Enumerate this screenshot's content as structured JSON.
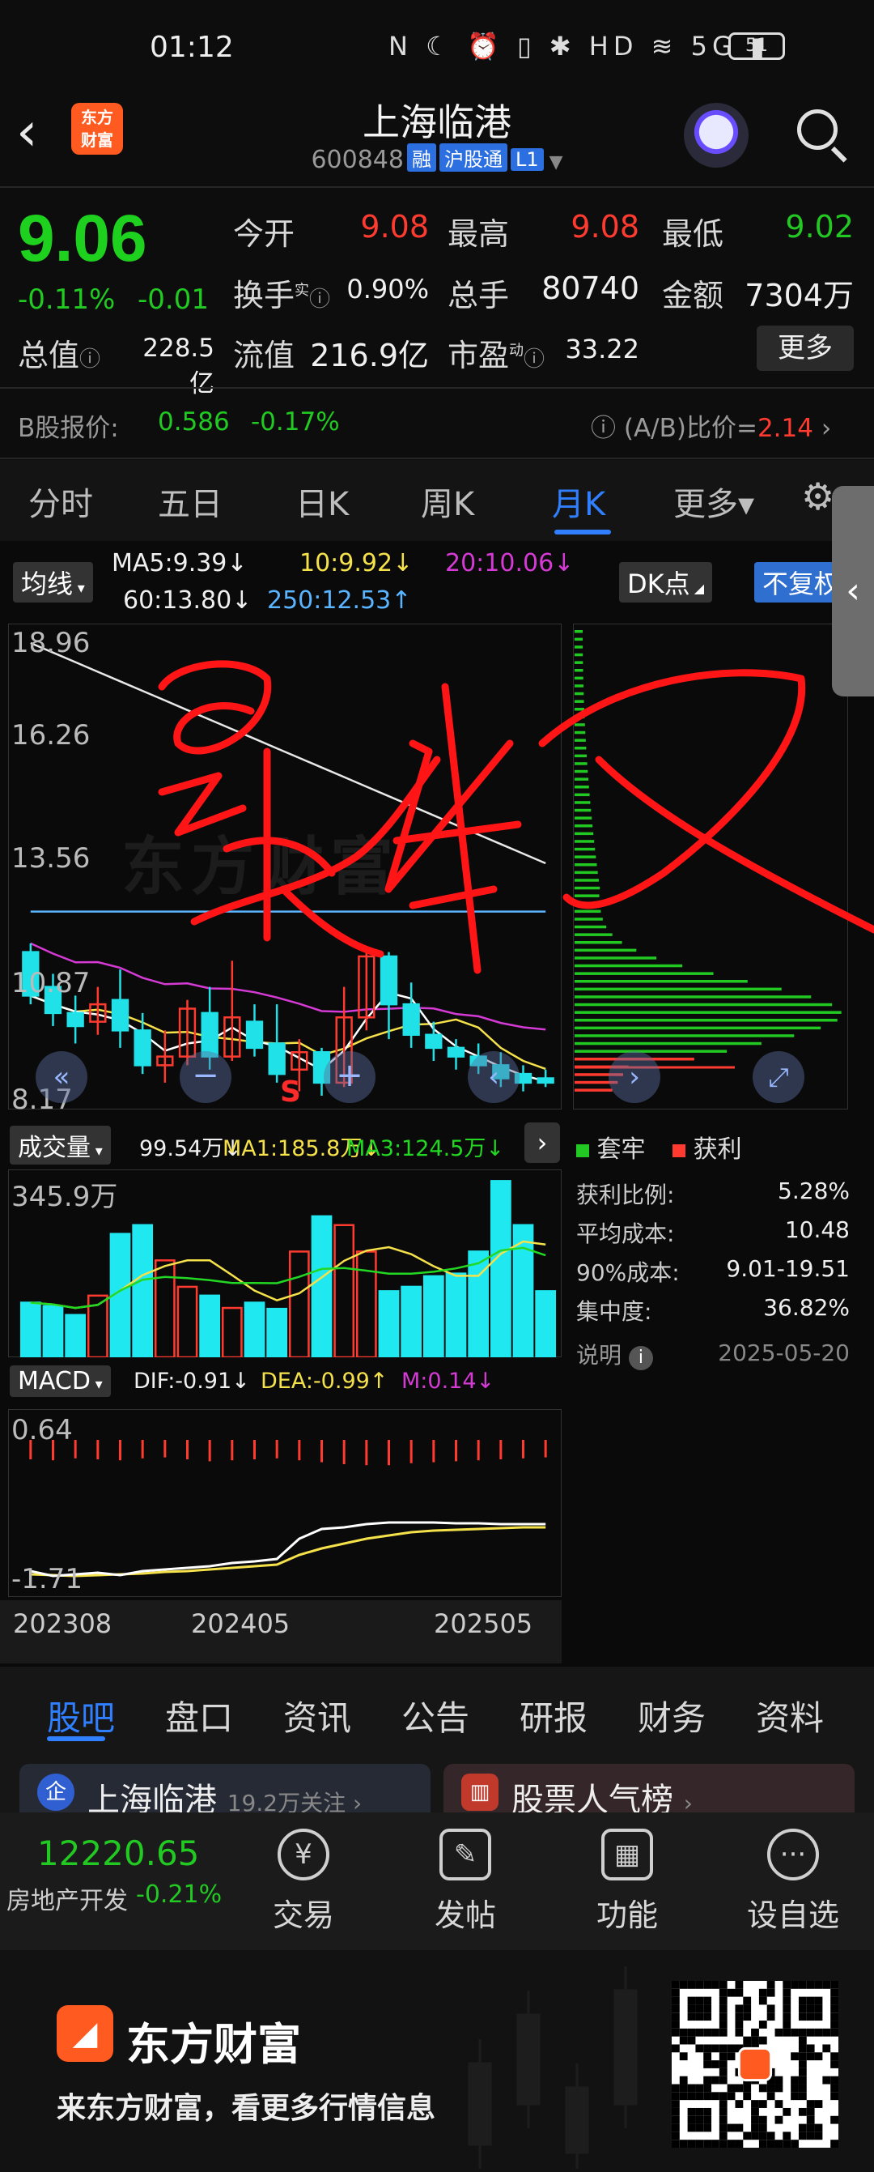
{
  "status": {
    "time": "01:12",
    "battery": "51",
    "icons": "N ☾ ⏰ ▯ ✱ HD ≋ 5G ▮"
  },
  "header": {
    "back": "‹",
    "brand_logo_text": "东方\n财富",
    "title": "上海临港",
    "code": "600848",
    "tags": [
      "融",
      "沪股通",
      "L1"
    ]
  },
  "quote": {
    "price": "9.06",
    "change_pct": "-0.11%",
    "change": "-0.01",
    "open_label": "今开",
    "open": "9.08",
    "high_label": "最高",
    "high": "9.08",
    "low_label": "最低",
    "low": "9.02",
    "turnover_label": "换手",
    "turnover_sup": "实",
    "turnover": "0.90%",
    "volume_label": "总手",
    "volume": "80740",
    "amount_label": "金额",
    "amount": "7304万",
    "mktcap_label": "总值",
    "mktcap": "228.5亿",
    "float_label": "流值",
    "float": "216.9亿",
    "pe_label": "市盈",
    "pe_sup": "动",
    "pe": "33.22",
    "more": "更多"
  },
  "bshare": {
    "label": "B股报价:",
    "price": "0.586",
    "pct": "-0.17%",
    "ratio_label": "(A/B)比价=",
    "ratio": "2.14"
  },
  "kline_tabs": [
    "分时",
    "五日",
    "日K",
    "周K",
    "月K",
    "更多▾"
  ],
  "chart": {
    "ma_selector": "均线",
    "ma5": "MA5:9.39↓",
    "ma10": "10:9.92↓",
    "ma20": "20:10.06↓",
    "ma60": "60:13.80↓",
    "ma250": "250:12.53↑",
    "dk_btn": "DK点",
    "fq_btn": "不复权",
    "y_ticks": [
      "18.96",
      "16.26",
      "13.56",
      "10.87",
      "8.17"
    ],
    "watermark": "东方财富",
    "handwriting": "最牛叉",
    "signal": "S",
    "volume_selector": "成交量",
    "vol_legend": [
      "99.54万↓",
      "MA1:185.8万↓",
      "MA3:124.5万↓"
    ],
    "vol_max": "345.9万",
    "macd_selector": "MACD",
    "macd_legend": [
      "DIF:-0.91↓",
      "DEA:-0.99↑",
      "M:0.14↓"
    ],
    "macd_max": "0.64",
    "macd_min": "-1.71",
    "x_ticks": [
      "202308",
      "202405",
      "202505"
    ]
  },
  "chip": {
    "legend_trapped": "套牢",
    "legend_profit": "获利",
    "rows": [
      {
        "label": "获利比例:",
        "value": "5.28%"
      },
      {
        "label": "平均成本:",
        "value": "10.48"
      },
      {
        "label": "90%成本:",
        "value": "9.01-19.51"
      },
      {
        "label": "集中度:",
        "value": "36.82%"
      }
    ],
    "note_label": "说明",
    "date": "2025-05-20"
  },
  "chart_data": {
    "type": "candlestick",
    "period": "monthly",
    "ylim": [
      8.17,
      18.96
    ],
    "candles": [
      {
        "o": 11.6,
        "c": 10.6,
        "h": 11.8,
        "l": 10.4
      },
      {
        "o": 10.8,
        "c": 10.2,
        "h": 11.1,
        "l": 9.9
      },
      {
        "o": 10.2,
        "c": 9.9,
        "h": 10.6,
        "l": 9.5
      },
      {
        "o": 10.0,
        "c": 10.4,
        "h": 10.8,
        "l": 9.7
      },
      {
        "o": 10.5,
        "c": 9.8,
        "h": 11.2,
        "l": 9.4
      },
      {
        "o": 9.8,
        "c": 9.0,
        "h": 10.2,
        "l": 8.8
      },
      {
        "o": 9.0,
        "c": 9.2,
        "h": 9.8,
        "l": 8.6
      },
      {
        "o": 9.2,
        "c": 10.3,
        "h": 10.5,
        "l": 9.0
      },
      {
        "o": 10.2,
        "c": 9.2,
        "h": 10.8,
        "l": 8.9
      },
      {
        "o": 9.2,
        "c": 10.1,
        "h": 11.4,
        "l": 9.1
      },
      {
        "o": 10.0,
        "c": 9.4,
        "h": 10.4,
        "l": 9.2
      },
      {
        "o": 9.5,
        "c": 8.8,
        "h": 10.4,
        "l": 8.6
      },
      {
        "o": 8.9,
        "c": 9.3,
        "h": 9.6,
        "l": 8.4
      },
      {
        "o": 9.3,
        "c": 8.6,
        "h": 9.4,
        "l": 8.3
      },
      {
        "o": 8.6,
        "c": 10.1,
        "h": 10.8,
        "l": 8.5
      },
      {
        "o": 10.1,
        "c": 11.5,
        "h": 11.7,
        "l": 9.8
      },
      {
        "o": 11.5,
        "c": 10.4,
        "h": 11.6,
        "l": 9.6
      },
      {
        "o": 10.4,
        "c": 9.7,
        "h": 10.9,
        "l": 9.4
      },
      {
        "o": 9.7,
        "c": 9.4,
        "h": 10.0,
        "l": 9.1
      },
      {
        "o": 9.4,
        "c": 9.2,
        "h": 9.6,
        "l": 8.9
      },
      {
        "o": 9.2,
        "c": 9.0,
        "h": 9.5,
        "l": 8.8
      },
      {
        "o": 9.0,
        "c": 8.7,
        "h": 9.3,
        "l": 8.5
      },
      {
        "o": 8.8,
        "c": 8.6,
        "h": 9.0,
        "l": 8.4
      },
      {
        "o": 8.7,
        "c": 8.6,
        "h": 8.9,
        "l": 8.5
      }
    ],
    "volume": [
      62,
      58,
      48,
      70,
      140,
      150,
      110,
      80,
      70,
      56,
      62,
      55,
      120,
      160,
      150,
      120,
      75,
      80,
      92,
      95,
      120,
      200,
      150,
      75
    ],
    "macd_hist": [
      0.4,
      0.42,
      0.38,
      0.4,
      0.42,
      0.38,
      0.36,
      0.4,
      0.44,
      0.42,
      0.4,
      0.38,
      0.42,
      0.46,
      0.5,
      0.52,
      0.52,
      0.48,
      0.46,
      0.44,
      0.42,
      0.4,
      0.38,
      0.36
    ]
  },
  "info_tabs": [
    "股吧",
    "盘口",
    "资讯",
    "公告",
    "研报",
    "财务",
    "资料"
  ],
  "cards": [
    {
      "title": "上海临港",
      "sub": "19.2万关注 ›"
    },
    {
      "title": "股票人气榜",
      "sub": "›"
    }
  ],
  "bottom_nav": {
    "index_value": "12220.65",
    "index_name": "房地产开发",
    "index_pct": "-0.21%",
    "items": [
      "交易",
      "发帖",
      "功能",
      "设自选"
    ]
  },
  "promo": {
    "brand": "东方财富",
    "slogan": "来东方财富，看更多行情信息"
  }
}
